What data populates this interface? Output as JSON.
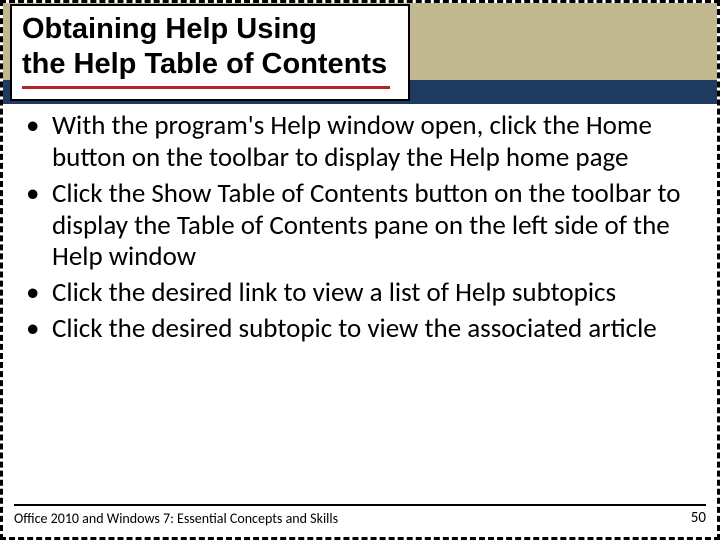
{
  "title": {
    "line1": "Obtaining Help Using",
    "line2": "the Help Table of Contents"
  },
  "bullets": [
    "With the program's Help window open, click the Home button on the toolbar to display the Help home page",
    "Click the Show Table of Contents button on the toolbar to display the Table of Contents pane on the left side of the Help window",
    "Click the desired link to view a list of Help subtopics",
    "Click the desired subtopic to view the associated article"
  ],
  "footer": {
    "source": "Office 2010 and Windows 7: Essential Concepts and Skills",
    "page": "50"
  }
}
